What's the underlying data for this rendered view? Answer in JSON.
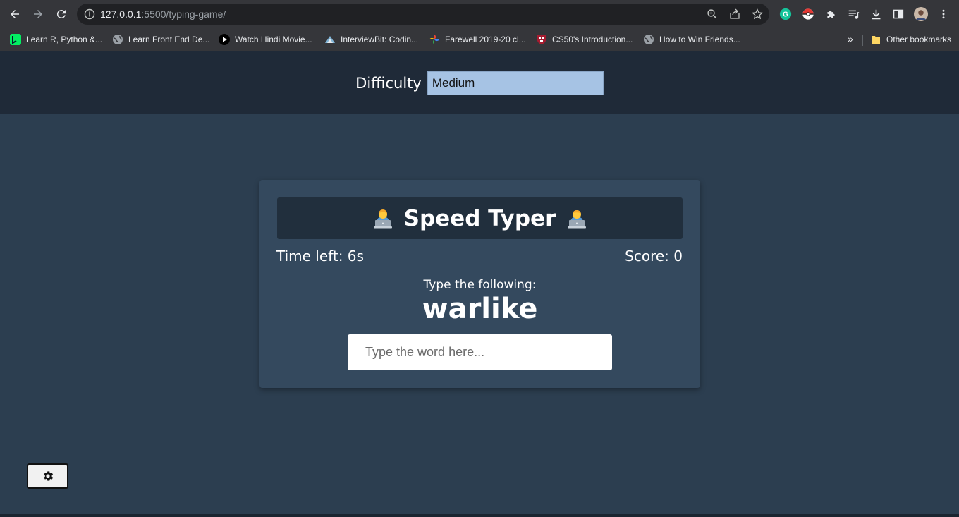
{
  "browser": {
    "url_host": "127.0.0.1",
    "url_path": ":5500/typing-game/",
    "bookmarks": [
      {
        "label": "Learn R, Python &...",
        "icon": "datacamp-icon",
        "color": "#03ef62"
      },
      {
        "label": "Learn Front End De...",
        "icon": "globe-icon",
        "color": "#9aa0a6"
      },
      {
        "label": "Watch Hindi Movie...",
        "icon": "play-icon",
        "color": "#000000"
      },
      {
        "label": "InterviewBit: Codin...",
        "icon": "interviewbit-icon",
        "color": "#7fb3d5"
      },
      {
        "label": "Farewell 2019-20 cl...",
        "icon": "pinwheel-icon",
        "color": "#ea4335"
      },
      {
        "label": "CS50's Introduction...",
        "icon": "harvard-icon",
        "color": "#a51c30"
      },
      {
        "label": "How to Win Friends...",
        "icon": "globe-icon",
        "color": "#9aa0a6"
      }
    ],
    "more_bookmarks": "»",
    "other_bookmarks": "Other bookmarks"
  },
  "settings": {
    "difficulty_label": "Difficulty",
    "difficulty_value": "Medium"
  },
  "game": {
    "title": "Speed Typer",
    "time_left_label": "Time left: 6s",
    "score_label": "Score: 0",
    "prompt": "Type the following:",
    "word": "warlike",
    "input_placeholder": "Type the word here..."
  },
  "colors": {
    "page_bg": "#2c3e50",
    "settings_bar_bg": "#1f2a38",
    "card_bg": "#34495e",
    "title_bg": "#212f3d",
    "select_bg": "#a6c3e4"
  },
  "icons": {
    "title_left": "technologist-icon",
    "title_right": "technologist-icon",
    "settings_button": "gear-icon"
  }
}
